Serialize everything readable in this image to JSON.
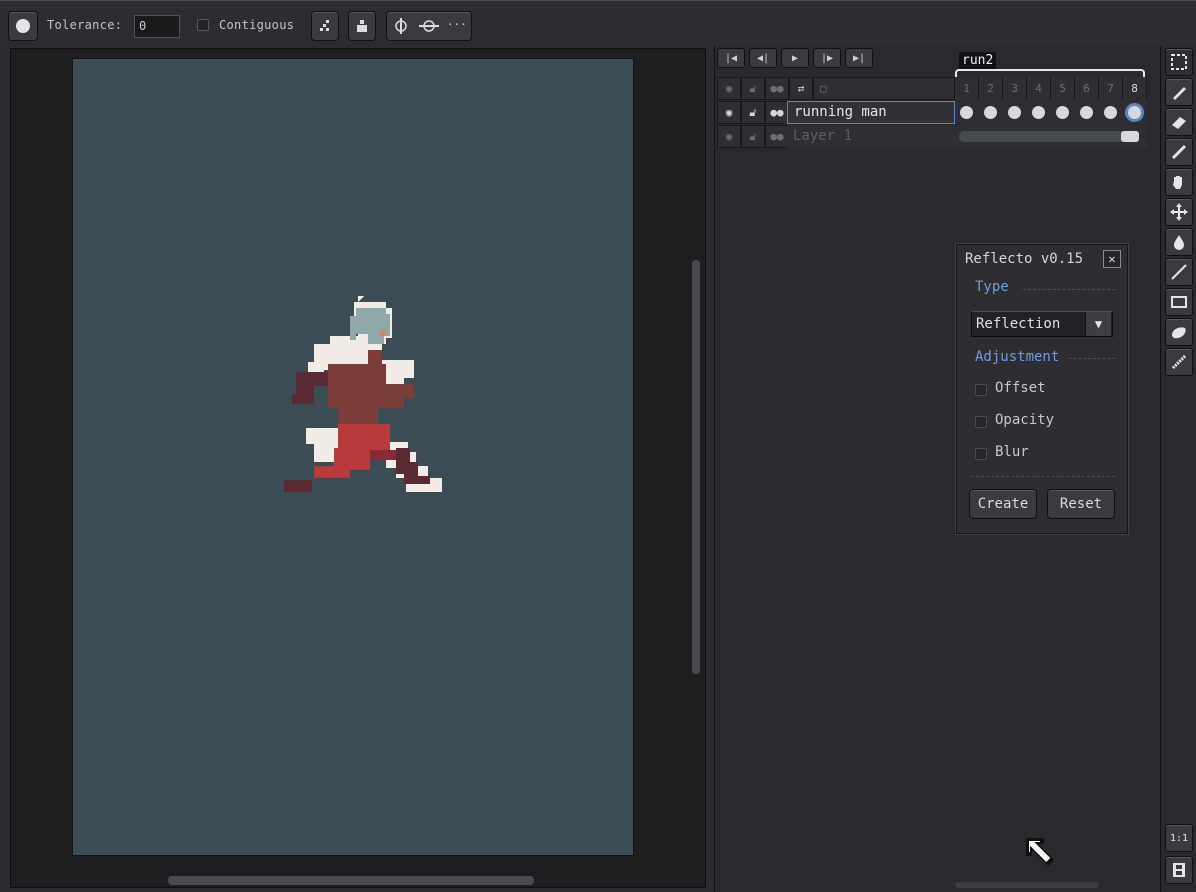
{
  "toolbar": {
    "tolerance_label": "Tolerance:",
    "tolerance_value": "0",
    "contiguous_label": "Contiguous",
    "more_label": "···",
    "icons": [
      "brush-shape-icon",
      "pixel-perfect-icon",
      "ink-icon",
      "symmetry-vertical-icon",
      "symmetry-horizontal-icon"
    ]
  },
  "timeline": {
    "playback": [
      "first-frame",
      "previous-frame",
      "play",
      "next-frame",
      "last-frame"
    ],
    "tag": "run2",
    "frames": [
      "1",
      "2",
      "3",
      "4",
      "5",
      "6",
      "7",
      "8"
    ],
    "active_frame": "8",
    "layers": [
      {
        "name": "running man",
        "selected": true,
        "cels": 8
      },
      {
        "name": "Layer 1",
        "selected": false,
        "linked_cel": true
      }
    ]
  },
  "dialog": {
    "title": "Reflecto v0.15",
    "close": "✕",
    "type_label": "Type",
    "type_value": "Reflection",
    "adjustment_label": "Adjustment",
    "options": [
      "Offset",
      "Opacity",
      "Blur"
    ],
    "create_label": "Create",
    "reset_label": "Reset"
  },
  "tools": {
    "items": [
      "marquee-icon",
      "pencil-icon",
      "eraser-icon",
      "eyedropper-icon",
      "hand-icon",
      "move-icon",
      "paint-bucket-icon",
      "line-icon",
      "rectangle-icon",
      "contour-icon",
      "blur-icon"
    ],
    "zoom_label": "1:1"
  },
  "colors": {
    "sprite_bg": "#3b4c54",
    "accent": "#6f9be0",
    "selection": "#5b86c4"
  }
}
